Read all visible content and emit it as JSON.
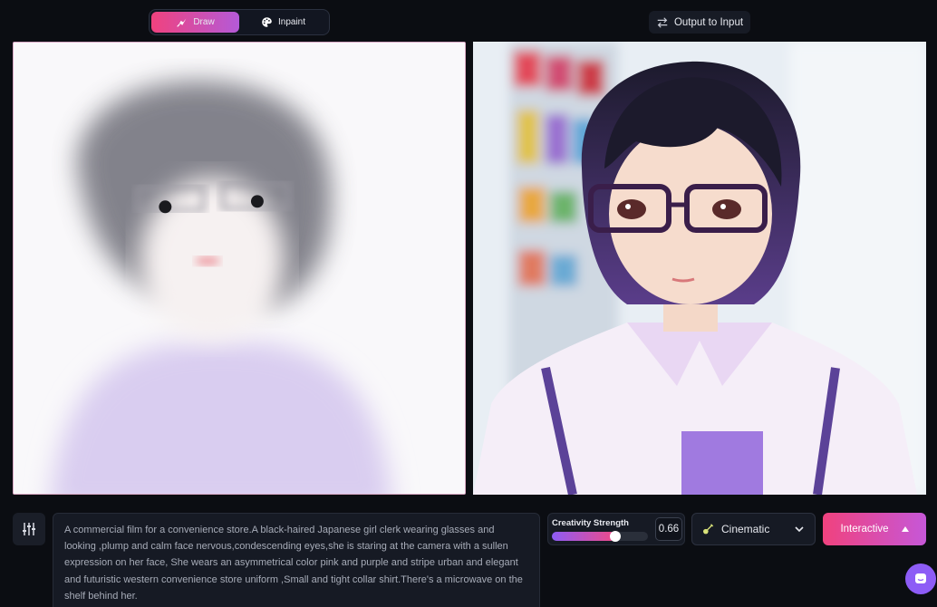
{
  "modes": [
    {
      "label": "Draw",
      "active": true,
      "icon": "brush-icon"
    },
    {
      "label": "Inpaint",
      "active": false,
      "icon": "palette-icon"
    }
  ],
  "output_to_input": {
    "label": "Output to Input",
    "icon": "swap-arrows-icon"
  },
  "prompt": {
    "text": "A commercial film for a convenience store.A black-haired Japanese girl clerk wearing glasses and looking ,plump and calm face nervous,condescending eyes,she is staring at the camera with a sullen expression on her face, She wears an asymmetrical color pink and purple and stripe urban and elegant and futuristic western convenience store uniform ,Small and tight collar shirt.There's a microwave on the shelf behind her."
  },
  "creativity": {
    "label": "Creativity Strength",
    "value": "0.66",
    "fraction": 0.66
  },
  "style": {
    "label": "Cinematic",
    "icon": "guitar-icon"
  },
  "generate": {
    "label": "Interactive"
  },
  "colors": {
    "accent_pink": "#f0427e",
    "accent_purple": "#8d5cf6",
    "background": "#0b0d12"
  }
}
